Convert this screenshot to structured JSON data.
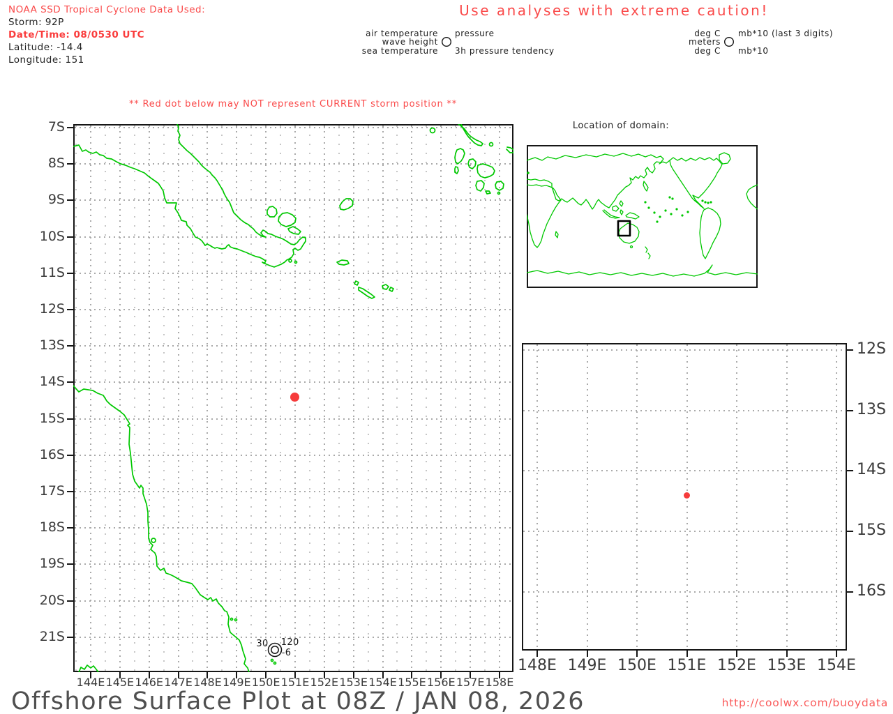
{
  "header": {
    "source_label": "NOAA SSD Tropical Cyclone Data Used:",
    "storm_line": "Storm: 92P",
    "datetime_line": "Date/Time: 08/0530 UTC",
    "latitude_line": "Latitude: -14.4",
    "longitude_line": "Longitude: 151",
    "caution": "Use analyses with extreme caution!"
  },
  "station_legend": {
    "air": "air temperature",
    "wave": "wave height",
    "sea": "sea temperature",
    "pressure": "pressure",
    "tendency": "3h pressure tendency"
  },
  "units_legend": {
    "air": "deg C",
    "wave": "meters",
    "sea": "deg C",
    "pressure": "mb*10 (last 3 digits)",
    "tendency": "mb*10"
  },
  "warning": "** Red dot below may NOT represent CURRENT storm position **",
  "main_map": {
    "lat_labels": [
      "7S",
      "8S",
      "9S",
      "10S",
      "11S",
      "12S",
      "13S",
      "14S",
      "15S",
      "16S",
      "17S",
      "18S",
      "19S",
      "20S",
      "21S"
    ],
    "lon_labels": [
      "144E",
      "145E",
      "146E",
      "147E",
      "148E",
      "149E",
      "150E",
      "151E",
      "152E",
      "153E",
      "154E",
      "155E",
      "156E",
      "157E",
      "158E"
    ],
    "storm": {
      "lon": 151,
      "lat": -14.4
    },
    "station": {
      "lon": 150.3,
      "lat": -21.35,
      "air_temp": "30",
      "pressure": "120",
      "tendency": "-6"
    }
  },
  "domain_inset": {
    "title": "Location of domain:"
  },
  "zoom_inset": {
    "lat_labels": [
      "12S",
      "13S",
      "14S",
      "15S",
      "16S"
    ],
    "lon_labels": [
      "148E",
      "149E",
      "150E",
      "151E",
      "152E",
      "153E",
      "154E"
    ],
    "storm": {
      "lon": 151,
      "lat": -14.4
    }
  },
  "footer": {
    "title": "Offshore Surface Plot at 08Z / JAN 08, 2026",
    "url": "http://coolwx.com/buoydata"
  },
  "colors": {
    "alert_red": "#fa4a4a",
    "coast_green": "#00c800",
    "storm_red": "#f63b3b"
  }
}
